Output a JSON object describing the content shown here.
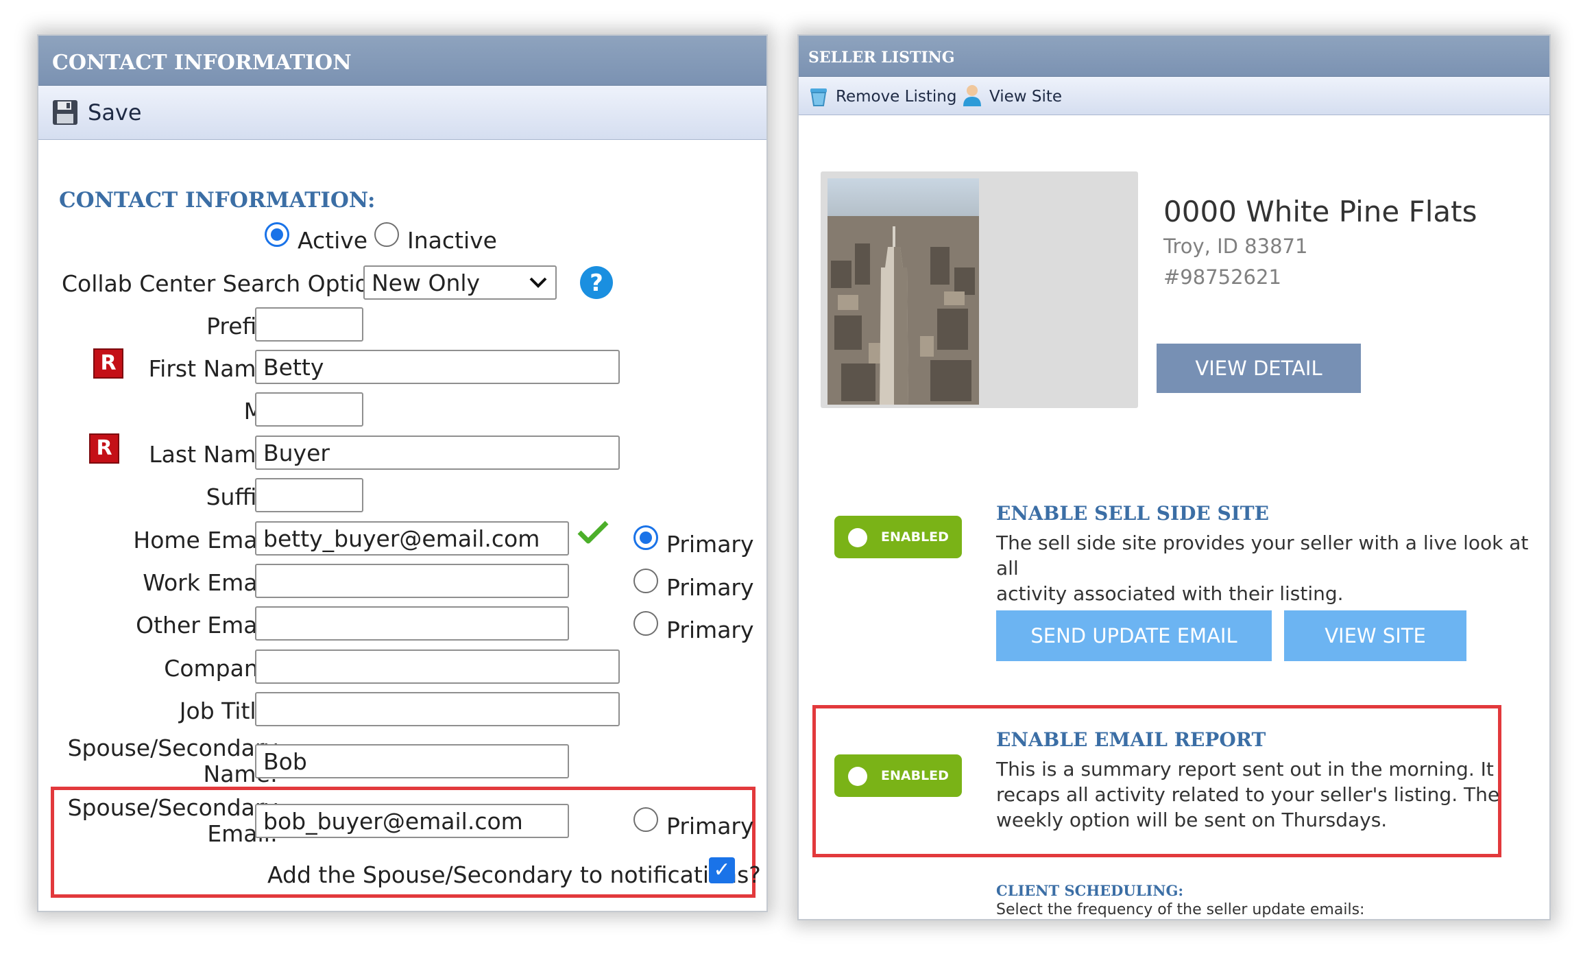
{
  "left": {
    "title": "CONTACT INFORMATION",
    "toolbar": {
      "save_label": "Save"
    },
    "section_heading": "CONTACT INFORMATION:",
    "status": {
      "active_label": "Active",
      "inactive_label": "Inactive",
      "selected": "Active"
    },
    "collab": {
      "label": "Collab Center Search Options:",
      "value": "New Only"
    },
    "required_marker": "R",
    "fields": {
      "prefix_label": "Prefix:",
      "prefix_value": "",
      "first_label": "First Name:",
      "first_value": "Betty",
      "mi_label": "MI:",
      "mi_value": "",
      "last_label": "Last Name:",
      "last_value": "Buyer",
      "suffix_label": "Suffix:",
      "suffix_value": "",
      "home_email_label": "Home Email:",
      "home_email_value": "betty_buyer@email.com",
      "work_email_label": "Work Email:",
      "work_email_value": "",
      "other_email_label": "Other Email:",
      "other_email_value": "",
      "company_label": "Company:",
      "company_value": "",
      "job_title_label": "Job Title:",
      "job_title_value": "",
      "spouse_name_label_1": "Spouse/Secondary",
      "spouse_name_label_2": "Name:",
      "spouse_name_value": "Bob",
      "spouse_email_label_1": "Spouse/Secondary",
      "spouse_email_label_2": "Email:",
      "spouse_email_value": "bob_buyer@email.com"
    },
    "primary_label": "Primary",
    "notify_label": "Add the Spouse/Secondary to notifications?",
    "notify_checked": true
  },
  "right": {
    "title": "SELLER LISTING",
    "toolbar": {
      "remove_label": "Remove Listing",
      "view_site_label": "View Site"
    },
    "listing": {
      "address": "0000 White Pine Flats",
      "city": "Troy, ID 83871",
      "mls": "#98752621",
      "view_detail": "VIEW DETAIL"
    },
    "sell_side": {
      "heading": "ENABLE SELL SIDE SITE",
      "toggle": "ENABLED",
      "desc_1": "The sell side site provides your seller with a live look at all",
      "desc_2": "activity associated with their listing.",
      "send_update": "SEND UPDATE EMAIL",
      "view_site": "VIEW SITE"
    },
    "email_report": {
      "heading": "ENABLE EMAIL REPORT",
      "toggle": "ENABLED",
      "desc_1": "This is a summary report sent out in the morning. It",
      "desc_2": "recaps all activity related to your seller's listing. The",
      "desc_3": "weekly option will be sent on Thursdays."
    },
    "scheduling": {
      "heading": "CLIENT SCHEDULING:",
      "desc": "Select the frequency of the seller update emails:"
    }
  },
  "colors": {
    "heading_blue": "#3b6ea5",
    "toggle_green": "#7ab317",
    "button_light_blue": "#6cb4f2",
    "button_slate": "#7790b4",
    "highlight_red": "#e2393c",
    "radio_blue": "#1a73e8"
  }
}
